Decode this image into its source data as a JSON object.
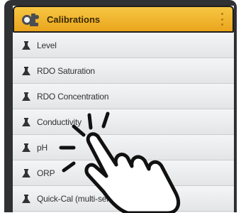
{
  "header": {
    "title": "Calibrations",
    "icon": "calibration-flask-icon"
  },
  "items": [
    {
      "label": "Level"
    },
    {
      "label": "RDO Saturation"
    },
    {
      "label": "RDO Concentration"
    },
    {
      "label": "Conductivity"
    },
    {
      "label": "pH"
    },
    {
      "label": "ORP"
    },
    {
      "label": "Quick-Cal (multi-sensor)"
    }
  ],
  "colors": {
    "header_accent": "#eaa51c",
    "row_bg": "#e9ebec"
  }
}
